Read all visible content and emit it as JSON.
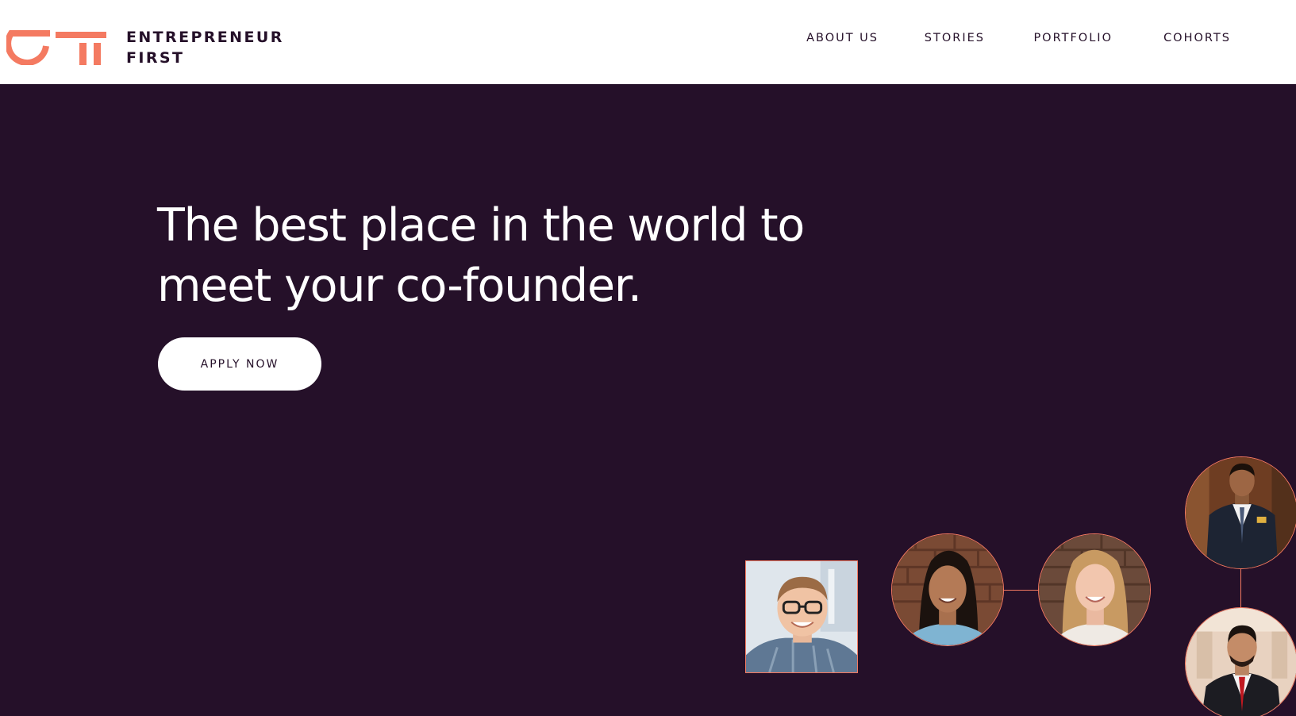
{
  "header": {
    "brand_line1": "ENTREPRENEUR",
    "brand_line2": "FIRST",
    "nav": [
      {
        "label": "ABOUT US"
      },
      {
        "label": "STORIES"
      },
      {
        "label": "PORTFOLIO"
      },
      {
        "label": "COHORTS"
      }
    ]
  },
  "hero": {
    "headline_line1": "The best place in the world to",
    "headline_line2": "meet your co-founder.",
    "cta_label": "APPLY NOW"
  },
  "colors": {
    "brand_orange": "#f47a61",
    "hero_bg": "#251029",
    "text_dark": "#251029",
    "white": "#ffffff"
  },
  "icons": {
    "logo": "ef-logo-icon"
  }
}
